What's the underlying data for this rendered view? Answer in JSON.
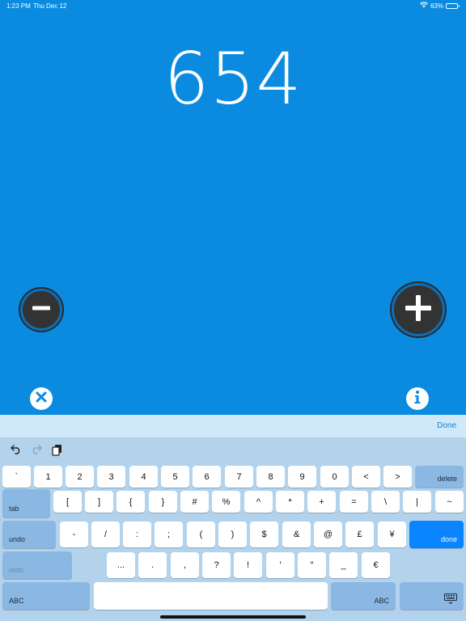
{
  "status": {
    "time": "1:23 PM",
    "date": "Thu Dec 12",
    "battery": "63%",
    "battery_level": 0.63
  },
  "counter": {
    "value": "654"
  },
  "done_bar": {
    "done_label": "Done"
  },
  "keyboard": {
    "row1": [
      "`",
      "1",
      "2",
      "3",
      "4",
      "5",
      "6",
      "7",
      "8",
      "9",
      "0",
      "<",
      ">"
    ],
    "delete": "delete",
    "tab": "tab",
    "row2": [
      "[",
      "]",
      "{",
      "}",
      "#",
      "%",
      "^",
      "*",
      "+",
      "=",
      "\\",
      "|",
      "~"
    ],
    "undo": "undo",
    "row3": [
      "-",
      "/",
      ":",
      ";",
      "(",
      ")",
      "$",
      "&",
      "@",
      "£",
      "¥"
    ],
    "done": "done",
    "redo": "redo",
    "row4": [
      "...",
      ".",
      ",",
      "?",
      "!",
      "′",
      "″",
      "_",
      "€"
    ],
    "abc_left": "ABC",
    "abc_right": "ABC"
  },
  "colors": {
    "background": "#0a8be0",
    "accent": "#0a84ff"
  }
}
